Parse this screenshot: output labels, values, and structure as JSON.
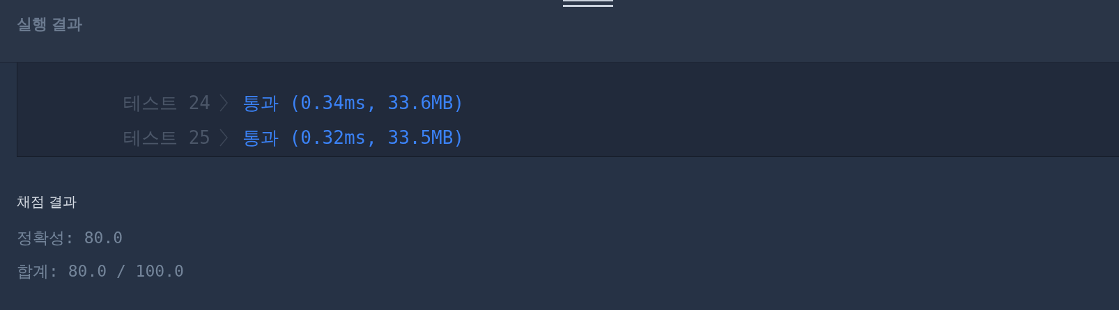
{
  "header": {
    "title": "실행 결과"
  },
  "tests": [
    {
      "label": "테스트 24",
      "result": "통과 (0.34ms, 33.6MB)"
    },
    {
      "label": "테스트 25",
      "result": "통과 (0.32ms, 33.5MB)"
    }
  ],
  "grading": {
    "title": "채점 결과",
    "lines": [
      "정확성: 80.0",
      "합계: 80.0 / 100.0"
    ]
  }
}
